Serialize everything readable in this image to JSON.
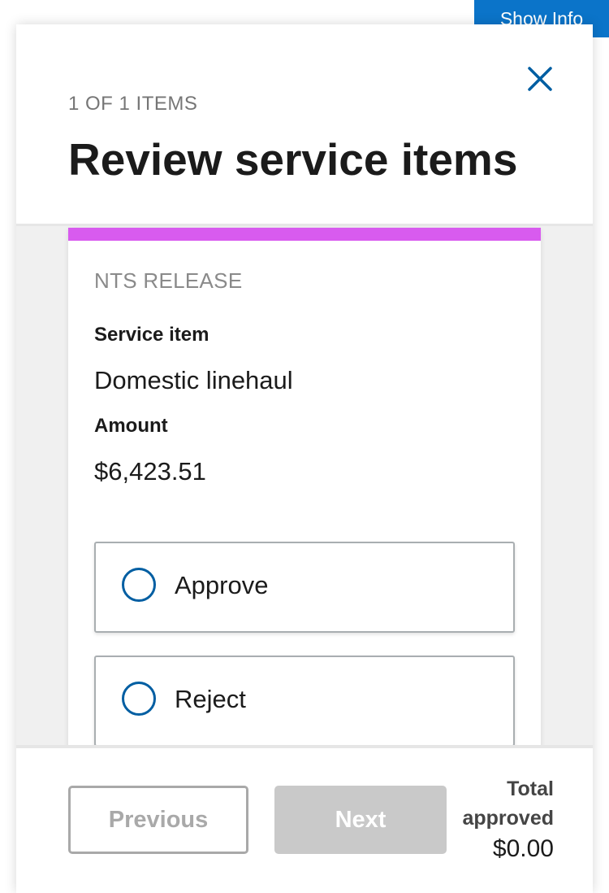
{
  "show_info_label": "Show Info",
  "header": {
    "counter": "1 OF 1 ITEMS",
    "title": "Review service items"
  },
  "card": {
    "category": "NTS RELEASE",
    "service_item_label": "Service item",
    "service_item_value": "Domestic linehaul",
    "amount_label": "Amount",
    "amount_value": "$6,423.51",
    "options": [
      {
        "label": "Approve"
      },
      {
        "label": "Reject"
      }
    ]
  },
  "footer": {
    "previous_label": "Previous",
    "next_label": "Next",
    "total_label": "Total approved",
    "total_value": "$0.00"
  },
  "colors": {
    "accent_blue": "#005ea2",
    "show_info_bg": "#0b74c9",
    "card_topbar": "#d85bef",
    "disabled_gray": "#c9c9c9"
  },
  "icons": {
    "close": "close-icon"
  }
}
